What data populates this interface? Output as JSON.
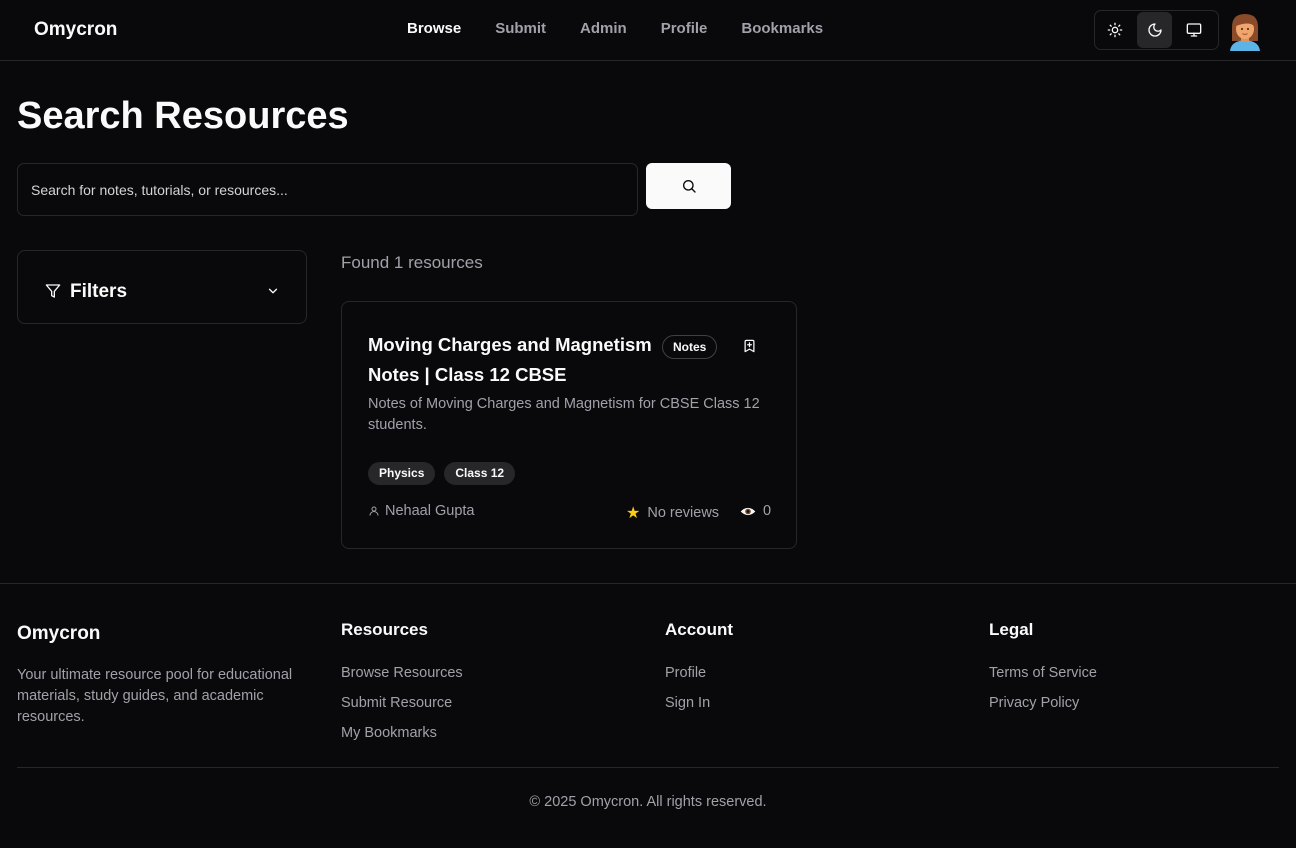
{
  "header": {
    "brand": "Omycron",
    "nav": [
      {
        "label": "Browse",
        "active": true
      },
      {
        "label": "Submit",
        "active": false
      },
      {
        "label": "Admin",
        "active": false
      },
      {
        "label": "Profile",
        "active": false
      },
      {
        "label": "Bookmarks",
        "active": false
      }
    ],
    "theme": {
      "options": [
        "sun-icon",
        "moon-icon",
        "monitor-icon"
      ],
      "selected": "moon-icon"
    }
  },
  "main": {
    "title": "Search Resources",
    "search": {
      "placeholder": "Search for notes, tutorials, or resources...",
      "value": ""
    },
    "filters": {
      "label": "Filters"
    },
    "results_count": "Found 1 resources",
    "results": [
      {
        "title": "Moving Charges and Magnetism Notes | Class 12 CBSE",
        "type_badge": "Notes",
        "description": "Notes of Moving Charges and Magnetism for CBSE Class 12 students.",
        "tags": [
          "Physics",
          "Class 12"
        ],
        "author": "Nehaal Gupta",
        "reviews": "No reviews",
        "views": "0"
      }
    ]
  },
  "footer": {
    "brand": "Omycron",
    "description": "Your ultimate resource pool for educational materials, study guides, and academic resources.",
    "columns": [
      {
        "heading": "Resources",
        "links": [
          "Browse Resources",
          "Submit Resource",
          "My Bookmarks"
        ]
      },
      {
        "heading": "Account",
        "links": [
          "Profile",
          "Sign In"
        ]
      },
      {
        "heading": "Legal",
        "links": [
          "Terms of Service",
          "Privacy Policy"
        ]
      }
    ],
    "copyright": "© 2025 Omycron. All rights reserved."
  },
  "colors": {
    "background": "#09090b",
    "border": "#27272a",
    "text": "#fafafa",
    "muted": "#a1a1aa",
    "star": "#facc15"
  }
}
